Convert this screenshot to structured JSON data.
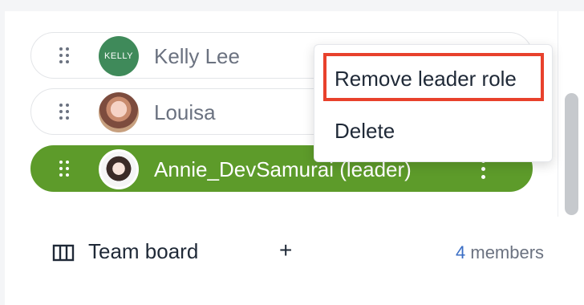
{
  "members": [
    {
      "name": "Kelly Lee",
      "avatar": "kelly-avatar",
      "avatar_text": "KELLY"
    },
    {
      "name": "Louisa",
      "avatar": "louisa-avatar"
    },
    {
      "name": "Annie_DevSamurai (leader)",
      "avatar": "annie-avatar",
      "leader": true
    }
  ],
  "menu": {
    "items": [
      "Remove leader role",
      "Delete"
    ],
    "highlighted": "Remove leader role"
  },
  "footer": {
    "board_label": "Team board",
    "add_symbol": "+",
    "member_count": "4",
    "member_label": "members"
  },
  "icons": [
    "drag-handle-icon",
    "more-options-icon",
    "board-icon",
    "plus-icon"
  ],
  "colors": {
    "leader_row": "#5d9b2a",
    "highlight": "#e8412c",
    "accent": "#3b6ec5"
  }
}
